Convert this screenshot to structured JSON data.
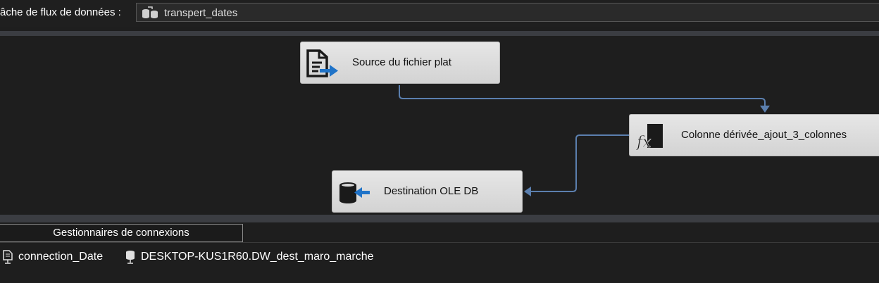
{
  "header": {
    "task_label": "âche de flux de données :",
    "task_value": "transpert_dates"
  },
  "nodes": {
    "source": {
      "label": "Source du fichier plat",
      "icon": "flat-file-source-icon"
    },
    "derived": {
      "label": "Colonne dérivée_ajout_3_colonnes",
      "icon": "derived-column-fx-icon"
    },
    "destination": {
      "label": "Destination OLE DB",
      "icon": "ole-db-destination-icon"
    }
  },
  "connections": {
    "tab_label": "Gestionnaires de connexions",
    "items": [
      {
        "label": "connection_Date",
        "icon": "flat-file-connection-icon"
      },
      {
        "label": "DESKTOP-KUS1R60.DW_dest_maro_marche",
        "icon": "ole-db-connection-icon"
      }
    ]
  },
  "colors": {
    "background": "#1e1e1e",
    "separator": "#3b3d42",
    "node_fill": "#dcdcdc",
    "path_arrow": "#5b7fae"
  }
}
